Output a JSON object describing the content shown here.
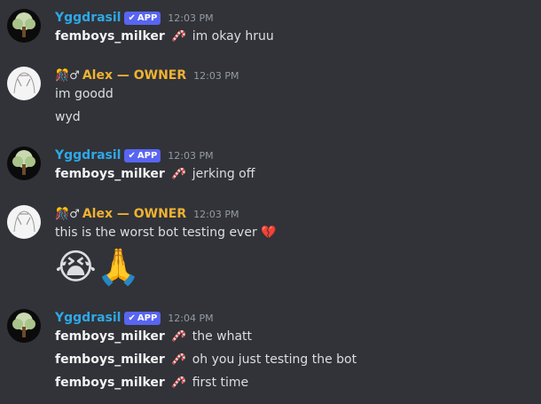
{
  "messages": [
    {
      "author": "Yggdrasil",
      "badge": "APP",
      "time": "12:03 PM",
      "lines": [
        {
          "user": "femboys_milker",
          "icon": "candy-cane-icon",
          "text": "im okay hruu"
        }
      ]
    },
    {
      "author": "Alex — OWNER",
      "author_prefix": "🎊♂",
      "time": "12:03 PM",
      "lines": [
        "im goodd",
        "wyd"
      ]
    },
    {
      "author": "Yggdrasil",
      "badge": "APP",
      "time": "12:03 PM",
      "lines": [
        {
          "user": "femboys_milker",
          "icon": "candy-cane-icon",
          "text": "jerking off"
        }
      ]
    },
    {
      "author": "Alex — OWNER",
      "author_prefix": "🎊♂",
      "time": "12:03 PM",
      "lines": [
        "this is the worst bot testing ever"
      ],
      "line_emoji": "💔",
      "big_emojis": "😭🙏"
    },
    {
      "author": "Yggdrasil",
      "badge": "APP",
      "time": "12:04 PM",
      "lines": [
        {
          "user": "femboys_milker",
          "icon": "candy-cane-icon",
          "text": "the whatt"
        },
        {
          "user": "femboys_milker",
          "icon": "candy-cane-icon",
          "text": "oh you just testing the bot"
        },
        {
          "user": "femboys_milker",
          "icon": "candy-cane-icon",
          "text": "first time"
        }
      ]
    }
  ]
}
